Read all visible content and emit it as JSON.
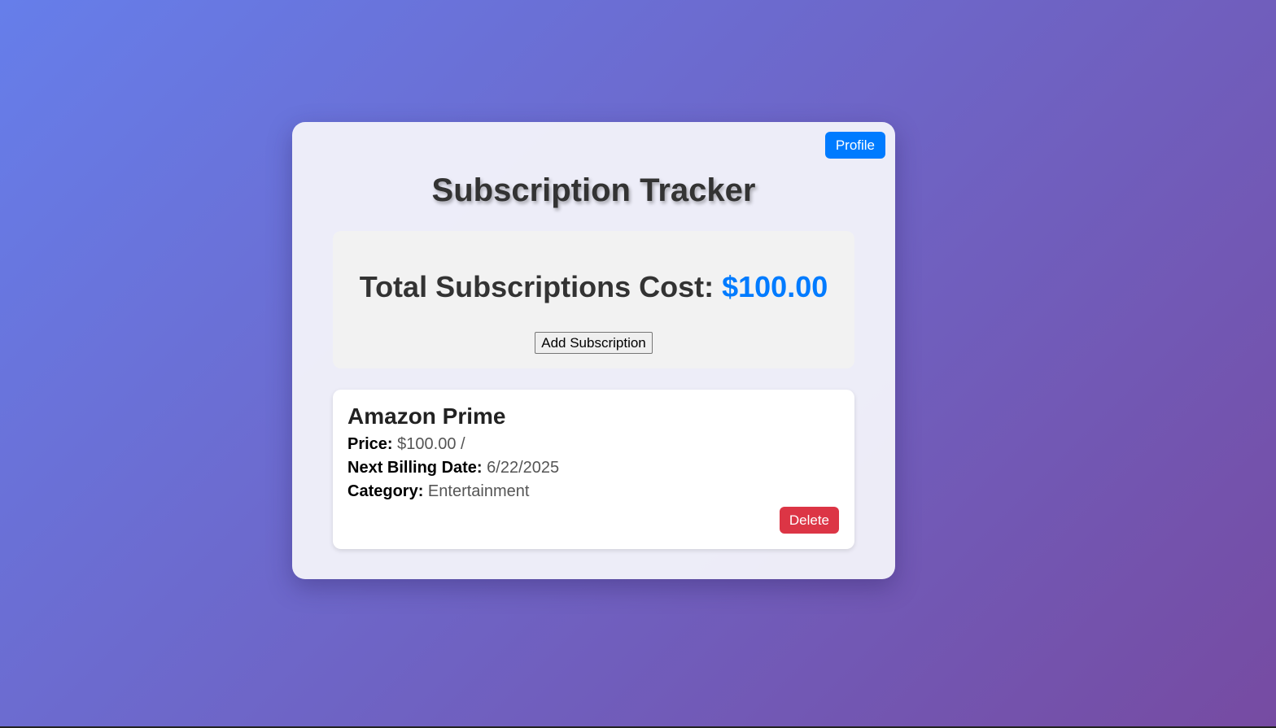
{
  "header": {
    "profile_label": "Profile",
    "title": "Subscription Tracker"
  },
  "summary": {
    "total_label": "Total Subscriptions Cost:",
    "total_amount": "$100.00",
    "add_label": "Add Subscription"
  },
  "subscriptions": [
    {
      "name": "Amazon Prime",
      "price_label": "Price:",
      "price_value": "$100.00 /",
      "billing_label": "Next Billing Date:",
      "billing_value": "6/22/2025",
      "category_label": "Category:",
      "category_value": "Entertainment",
      "delete_label": "Delete"
    }
  ],
  "colors": {
    "accent": "#007bff",
    "danger": "#dc3545",
    "background_start": "#667eea",
    "background_end": "#764ba2"
  }
}
